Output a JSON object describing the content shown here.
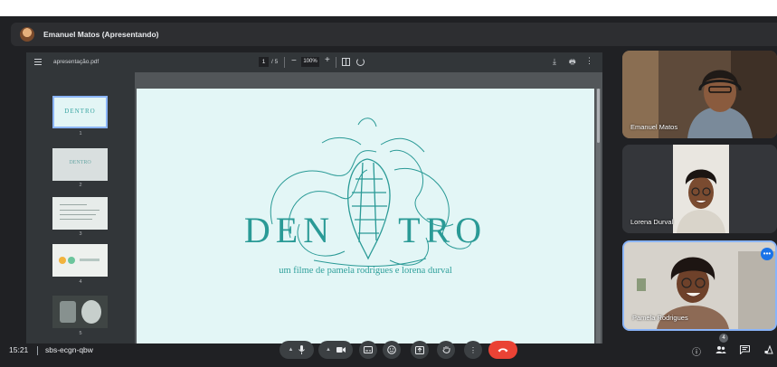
{
  "presenter": {
    "name": "Emanuel Matos (Apresentando)"
  },
  "pdf_viewer": {
    "filename": "apresentação.pdf",
    "current_page": "1",
    "page_total": "/ 5",
    "zoom": "100%",
    "thumbnails": [
      {
        "number": "1",
        "label": "DENTRO"
      },
      {
        "number": "2",
        "label": "DENTRO"
      },
      {
        "number": "3"
      },
      {
        "number": "4"
      },
      {
        "number": "5"
      }
    ]
  },
  "slide": {
    "title_left": "DEN",
    "title_right": "TRO",
    "subtitle": "um filme de pamela rodrigues e lorena durval",
    "accent_color": "#2a9a96"
  },
  "participants": [
    {
      "name": "Emanuel Matos"
    },
    {
      "name": "Lorena Durval"
    },
    {
      "name": "Pamela Rodrigues"
    }
  ],
  "meeting": {
    "time": "15:21",
    "code": "sbs-ecgn-qbw",
    "participant_count": "4"
  },
  "controls": {
    "icons": [
      "mic-icon",
      "camera-icon",
      "captions-icon",
      "emoji-icon",
      "present-icon",
      "raise-hand-icon",
      "more-options-icon",
      "end-call-icon",
      "info-icon",
      "people-icon",
      "chat-icon",
      "activities-icon"
    ],
    "end_call_color": "#ea4335",
    "selected_border_color": "#8ab4f8"
  }
}
